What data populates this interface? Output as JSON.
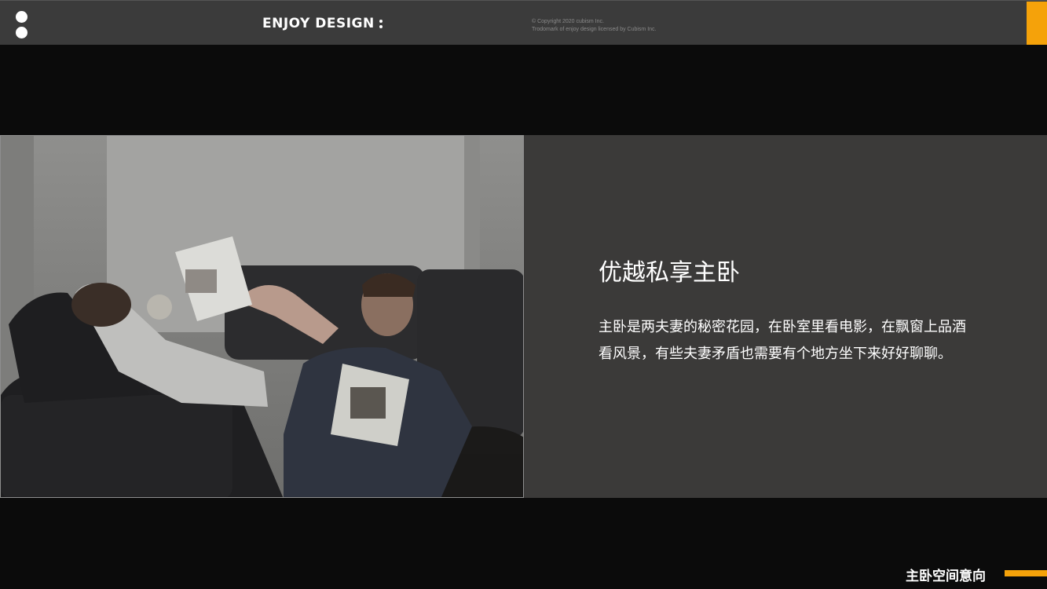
{
  "header": {
    "brand": "ENJOY DESIGN",
    "copyright_line1": "© Copyright 2020 cubism Inc.",
    "copyright_line2": "Trodomark of enjoy design licensed by Cubism Inc."
  },
  "content": {
    "heading": "优越私享主卧",
    "body_line1": "主卧是两夫妻的秘密花园，在卧室里看电影，在飘窗上品酒",
    "body_line2": "看风景，有些夫妻矛盾也需要有个地方坐下来好好聊聊。"
  },
  "footer": {
    "label": "主卧空间意向"
  },
  "colors": {
    "accent": "#f5a20a",
    "background": "#0b0b0b",
    "panel": "#3b3a39",
    "topbar": "#3b3b3b"
  }
}
